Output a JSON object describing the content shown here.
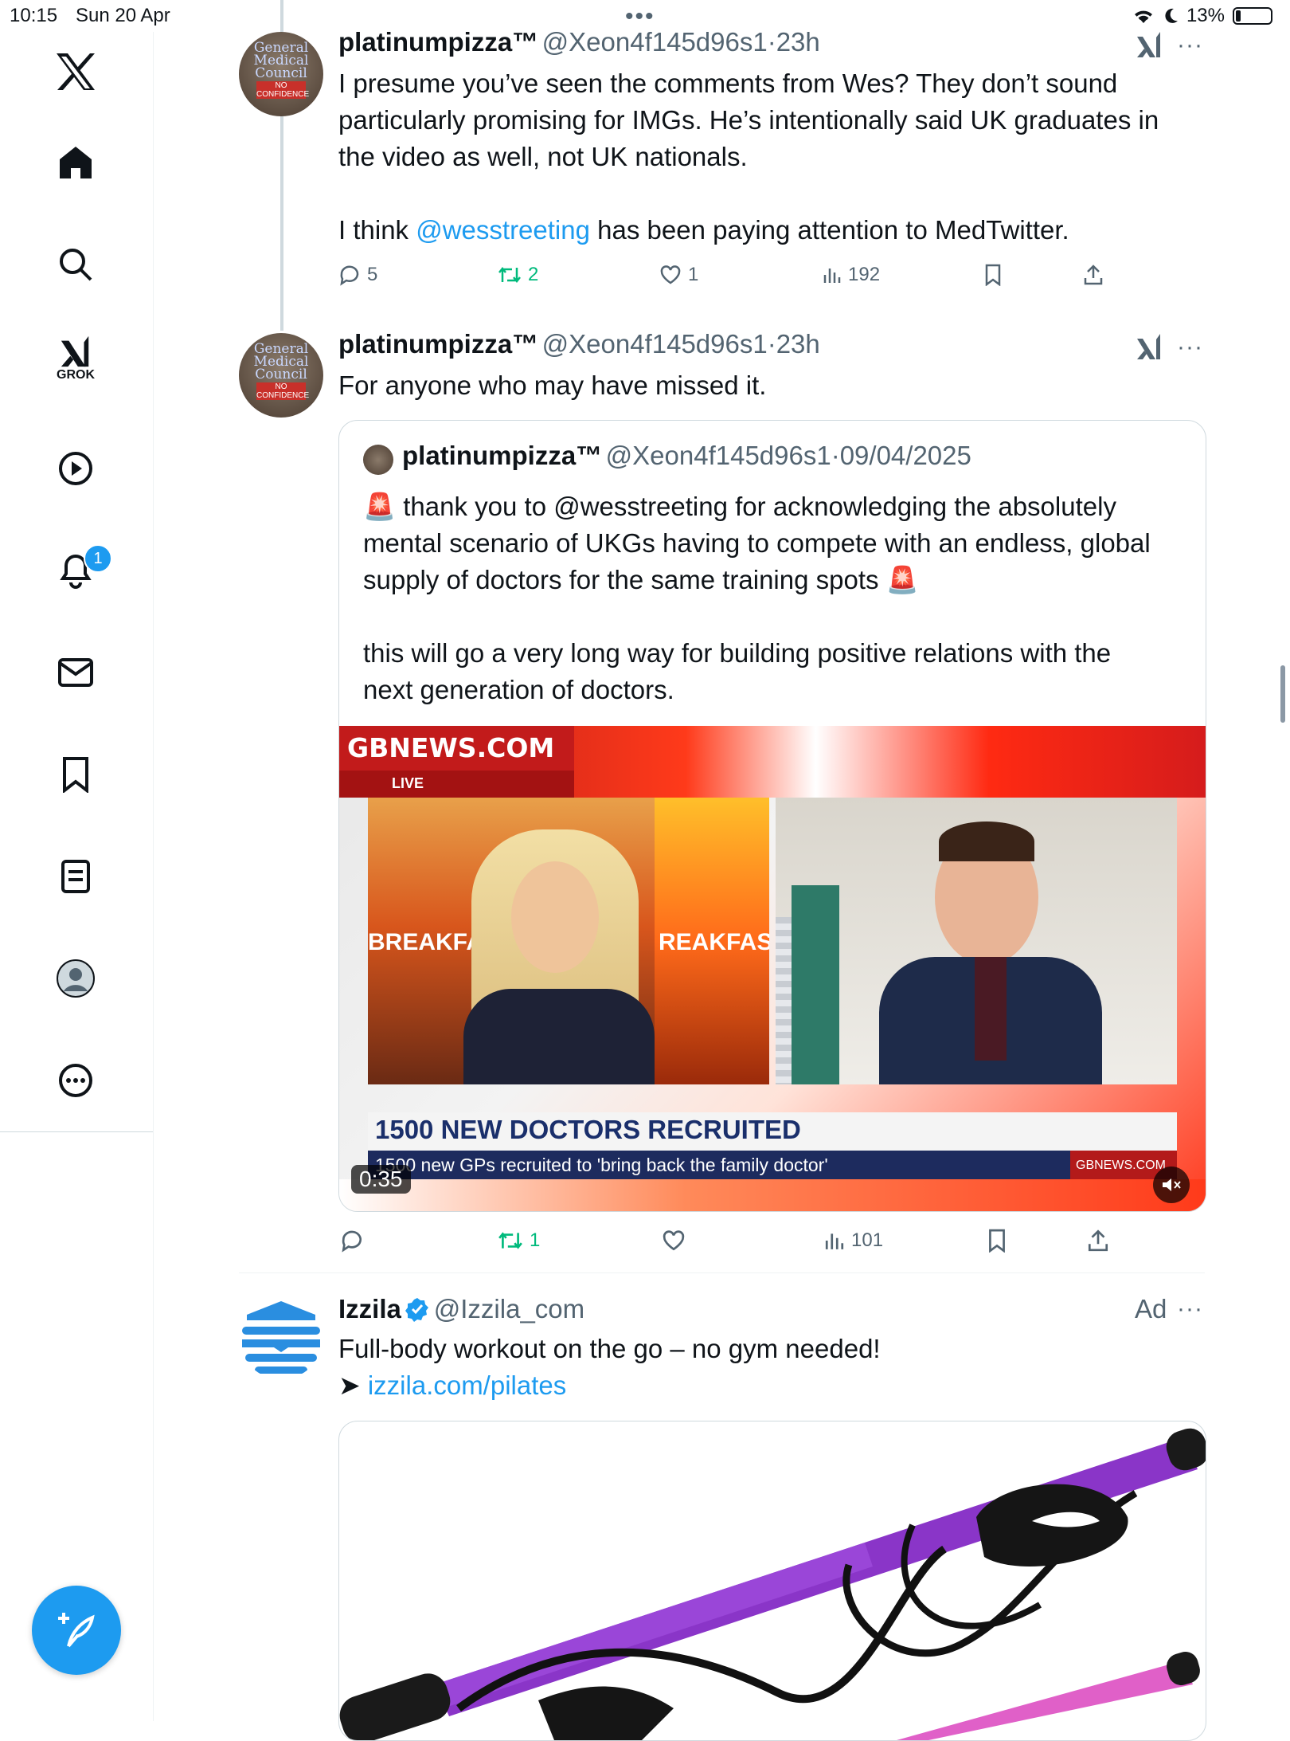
{
  "status_bar": {
    "time": "10:15",
    "date": "Sun 20 Apr",
    "battery": "13%"
  },
  "sidebar": {
    "grok_label": "GROK",
    "notification_count": "1",
    "items": [
      "x-logo",
      "home-icon",
      "search-icon",
      "grok-icon",
      "video-icon",
      "bell-icon",
      "mail-icon",
      "bookmark-icon",
      "lists-icon",
      "profile-icon",
      "more-icon"
    ]
  },
  "tweets": [
    {
      "name": "platinumpizza™",
      "handle": "@Xeon4f145d96s1",
      "sep": "·",
      "time": "23h",
      "text_line1": "I presume you’ve seen the comments from Wes? They don’t sound",
      "text_line2": "particularly promising for IMGs. He’s intentionally said UK graduates in",
      "text_line3": "the video as well, not UK nationals.",
      "text_line4_pre": "I think ",
      "text_line4_link": "@wesstreeting",
      "text_line4_post": " has been paying attention to MedTwitter.",
      "replies": "5",
      "retweets": "2",
      "likes": "1",
      "views": "192"
    },
    {
      "name": "platinumpizza™",
      "handle": "@Xeon4f145d96s1",
      "sep": "·",
      "time": "23h",
      "text": "For anyone who may have missed it.",
      "retweets": "1",
      "views": "101",
      "quote": {
        "name": "platinumpizza™",
        "handle": "@Xeon4f145d96s1",
        "sep": "·",
        "date": "09/04/2025",
        "line1": "🚨 thank you to @wesstreeting for acknowledging the absolutely",
        "line2": "mental scenario of UKGs having to compete with an endless, global",
        "line3": "supply of doctors for the same training spots 🚨",
        "line4": "this will go a very long way for building positive relations with the",
        "line5": "next generation of doctors.",
        "video": {
          "brand": "GBNEWS.COM",
          "live": "LIVE",
          "backdrop_left": "BREAKFAS",
          "backdrop_right": "REAKFAST",
          "headline": "1500 NEW DOCTORS RECRUITED",
          "subline": "1500 new GPs recruited to 'bring back the family doctor'",
          "corner": "GBNEWS.COM",
          "duration": "0:35"
        }
      }
    },
    {
      "name": "Izzila",
      "handle": "@Izzila_com",
      "ad_label": "Ad",
      "text": "Full-body workout on the go – no gym needed!",
      "arrow": "➤",
      "link": "izzila.com/pilates"
    }
  ],
  "colors": {
    "accent": "#1d9bf0",
    "retweet_green": "#00ba7c",
    "secondary_text": "#536471"
  },
  "avatar": {
    "line1": "General",
    "line2": "Medical",
    "line3": "Council",
    "stamp": "NO CONFIDENCE"
  }
}
